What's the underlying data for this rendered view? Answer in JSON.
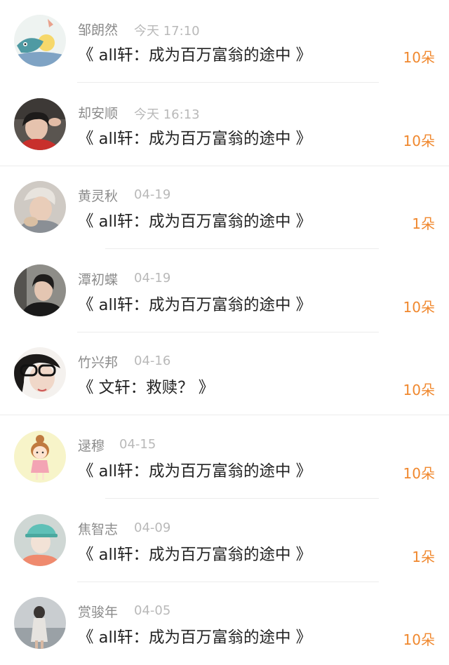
{
  "accent_color": "#f0882e",
  "items": [
    {
      "name": "邹朗然",
      "time": "今天 17:10",
      "title": "《 all轩：成为百万富翁的途中 》",
      "count": "10朵",
      "avatar": "cartoon-fish-avatar"
    },
    {
      "name": "却安顺",
      "time": "今天 16:13",
      "title": "《 all轩：成为百万富翁的途中 》",
      "count": "10朵",
      "avatar": "photo-avatar"
    },
    {
      "name": "黄灵秋",
      "time": "04-19",
      "title": "《 all轩：成为百万富翁的途中 》",
      "count": "1朵",
      "avatar": "photo-avatar"
    },
    {
      "name": "潭初蝶",
      "time": "04-19",
      "title": "《 all轩：成为百万富翁的途中 》",
      "count": "10朵",
      "avatar": "photo-avatar"
    },
    {
      "name": "竹兴邦",
      "time": "04-16",
      "title": "《 文轩：救赎？ 》",
      "count": "10朵",
      "avatar": "photo-avatar"
    },
    {
      "name": "逯穆",
      "time": "04-15",
      "title": "《 all轩：成为百万富翁的途中 》",
      "count": "10朵",
      "avatar": "cartoon-girl-avatar"
    },
    {
      "name": "焦智志",
      "time": "04-09",
      "title": "《 all轩：成为百万富翁的途中 》",
      "count": "1朵",
      "avatar": "illustration-avatar"
    },
    {
      "name": "赏骏年",
      "time": "04-05",
      "title": "《 all轩：成为百万富翁的途中 》",
      "count": "10朵",
      "avatar": "photo-avatar"
    }
  ]
}
